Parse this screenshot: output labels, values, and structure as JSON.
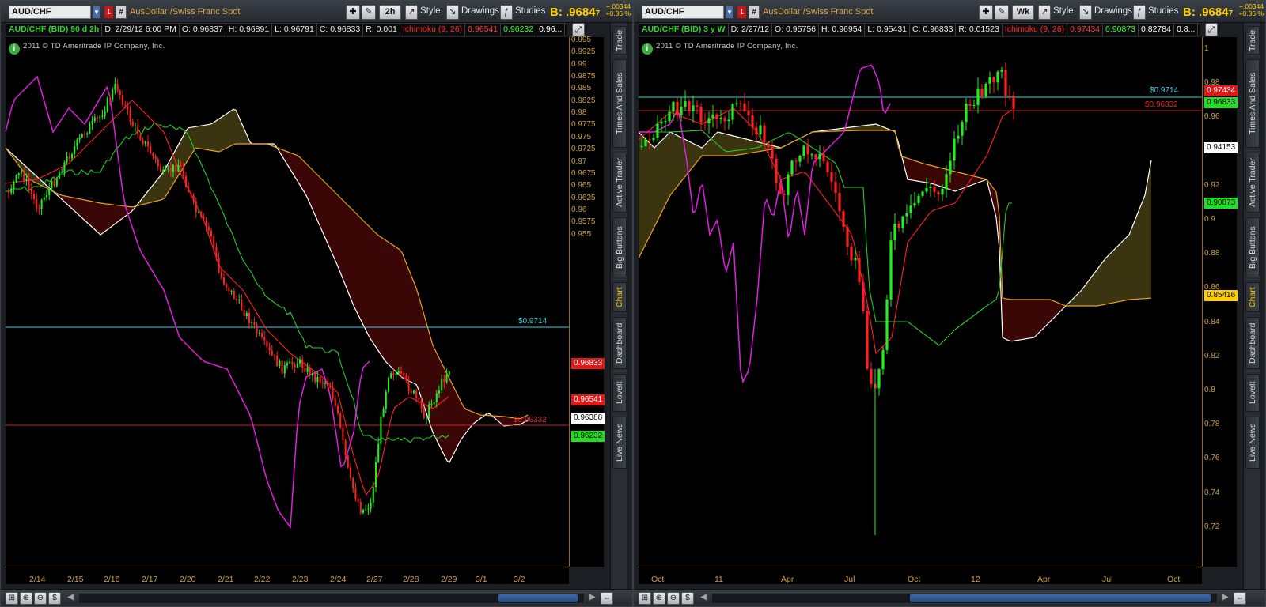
{
  "left": {
    "symbol": "AUD/CHF",
    "description": "AusDollar /Swiss Franc Spot",
    "timeframe": "2h",
    "toolbar": {
      "style": "Style",
      "drawings": "Drawings",
      "studies": "Studies"
    },
    "bid": "B: .9684",
    "bid_sub": "7",
    "change": "+.00344",
    "change_pct": "+0.36 %",
    "info": {
      "symbol": "AUD/CHF (BID) 90 d 2h",
      "date": "D: 2/29/12 6:00 PM",
      "open": "O: 0.96837",
      "high": "H: 0.96891",
      "low": "L: 0.96791",
      "close": "C: 0.96833",
      "range": "R: 0.001",
      "study": "Ichimoku (9, 26)",
      "v1": "0.96541",
      "v2": "0.96232",
      "v3": "0.96..."
    },
    "copyright": "2011 © TD Ameritrade IP Company, Inc.",
    "yticks": [
      "0.995",
      "0.9925",
      "0.99",
      "0.9875",
      "0.985",
      "0.9825",
      "0.98",
      "0.9775",
      "0.975",
      "0.9725",
      "0.97",
      "0.9675",
      "0.965",
      "0.9625",
      "0.96",
      "0.9575",
      "0.955"
    ],
    "xticks": [
      "2/14",
      "2/15",
      "2/16",
      "2/17",
      "2/20",
      "2/21",
      "2/22",
      "2/23",
      "2/24",
      "2/27",
      "2/28",
      "2/29",
      "3/1",
      "3/2"
    ],
    "labels": {
      "close": "0.96833",
      "tenkan": "0.96541",
      "kijun": "0.96388",
      "chikou": "0.96232",
      "hline1": "$0.9714",
      "hline2": "$0.96332"
    }
  },
  "right": {
    "symbol": "AUD/CHF",
    "description": "AusDollar /Swiss Franc Spot",
    "timeframe": "Wk",
    "toolbar": {
      "style": "Style",
      "drawings": "Drawings",
      "studies": "Studies"
    },
    "bid": "B: .9684",
    "bid_sub": "7",
    "change": "+.00344",
    "change_pct": "+0.36 %",
    "info": {
      "symbol": "AUD/CHF (BID) 3 y W",
      "date": "D: 2/27/12",
      "open": "O: 0.95756",
      "high": "H: 0.96954",
      "low": "L: 0.95431",
      "close": "C: 0.96833",
      "range": "R: 0.01523",
      "study": "Ichimoku (9, 26)",
      "v1": "0.97434",
      "v2": "0.90873",
      "v3": "0.82784",
      "v4": "0.8..."
    },
    "copyright": "2011 © TD Ameritrade IP Company, Inc.",
    "yticks": [
      "1",
      "0.98",
      "0.96",
      "0.94",
      "0.92",
      "0.9",
      "0.88",
      "0.86",
      "0.84",
      "0.82",
      "0.8",
      "0.78",
      "0.76",
      "0.74",
      "0.72"
    ],
    "xticks": [
      "Oct",
      "11",
      "Apr",
      "Jul",
      "Oct",
      "12",
      "Apr",
      "Jul",
      "Oct"
    ],
    "labels": {
      "tenkan": "0.97434",
      "close": "0.96833",
      "kijun": "0.94153",
      "chikou": "0.90873",
      "spanb": "0.85416",
      "hline1": "$0.9714",
      "hline2": "$0.96332"
    }
  },
  "sidetabs": [
    "Trade",
    "Times And Sales",
    "Active Trader",
    "Big Buttons",
    "Chart",
    "Dashboard",
    "LoveIt",
    "Live News"
  ],
  "colors": {
    "up": "#22ee22",
    "down": "#ff2020",
    "tenkan": "#ff2020",
    "kijun": "#22cc22",
    "chikou": "#e020e0",
    "spanA": "#ffffff",
    "spanB": "#e8a020",
    "cloud_bear": "#3a0606",
    "cloud_bull": "#3a3510",
    "hline1": "#40d0e0",
    "hline2": "#d02020"
  }
}
